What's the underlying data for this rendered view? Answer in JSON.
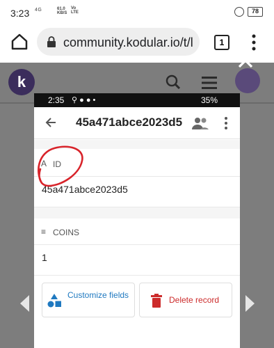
{
  "phone_status": {
    "time": "3:23",
    "network": "4G",
    "speed_value": "61.0",
    "speed_unit": "KB/S",
    "volte_top": "Vo",
    "volte_bottom": "LTE",
    "battery": "78"
  },
  "browser": {
    "url": "community.kodular.io/t/l",
    "tab_count": "1"
  },
  "background_page": {
    "avatar_letter": "k"
  },
  "inner_screenshot": {
    "status": {
      "time": "2:35",
      "battery": "35%"
    },
    "app_bar": {
      "title": "45a471abce2023d5"
    },
    "fields": [
      {
        "icon": "A",
        "label": "ID",
        "value": "45a471abce2023d5"
      },
      {
        "icon": "≡",
        "label": "COINS",
        "value": "1"
      }
    ],
    "buttons": {
      "customize": "Customize fields",
      "delete": "Delete record"
    }
  },
  "colors": {
    "accent_blue": "#1f79c0",
    "delete_red": "#cc2b2b",
    "annotation_red": "#d8232a",
    "overlay": "#7d7d7d"
  }
}
